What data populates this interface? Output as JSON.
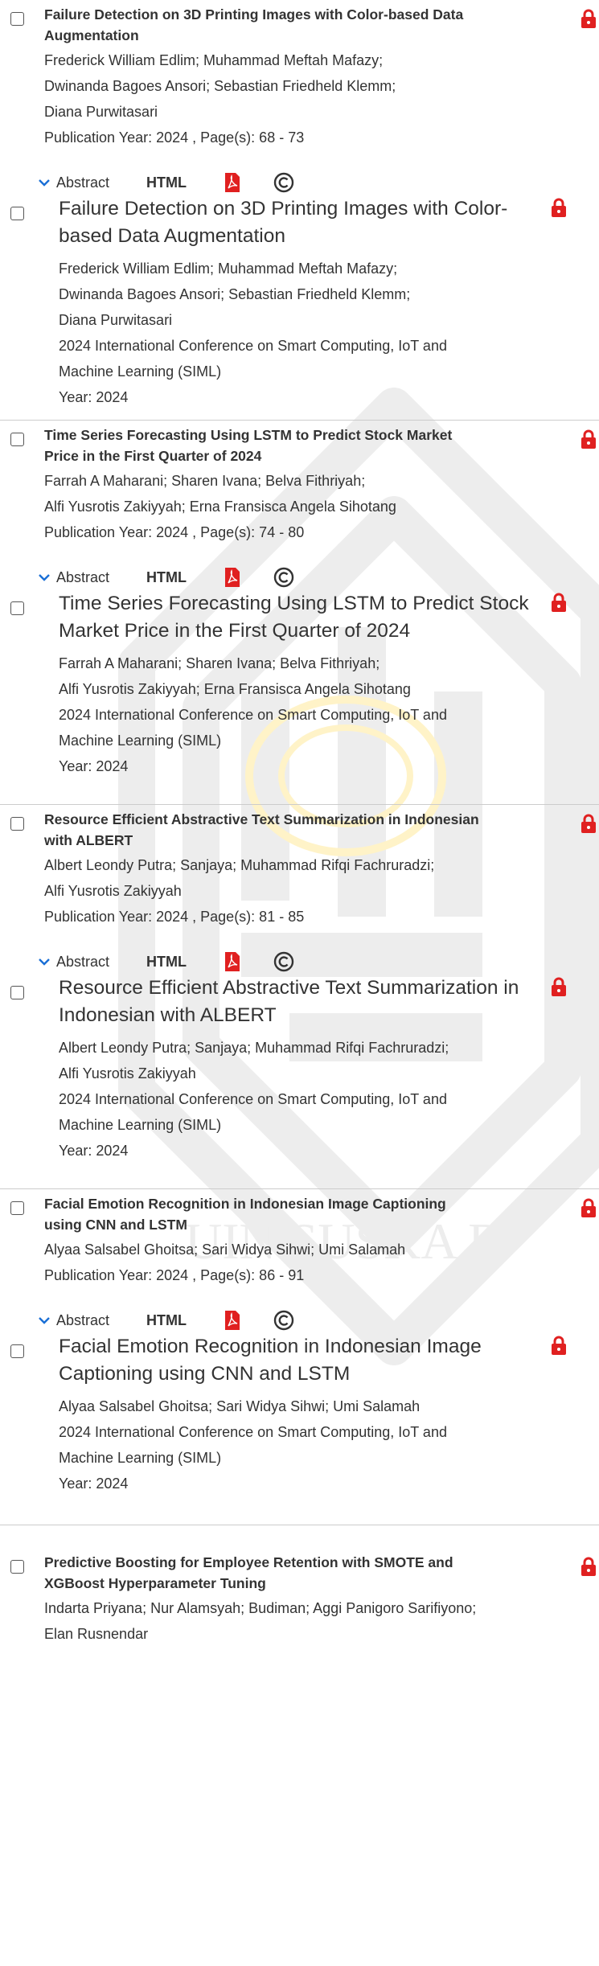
{
  "colors": {
    "accent_red": "#E02020",
    "text": "#333333",
    "watermark": "#EDEDED",
    "divider": "#CCCCCC"
  },
  "icons": {
    "checkbox": "checkbox-icon",
    "lock": "lock-icon",
    "chevron": "chevron-down-icon",
    "pdf": "pdf-icon",
    "copyright": "copyright-icon"
  },
  "labels": {
    "abstract": "Abstract",
    "html": "HTML"
  },
  "watermark_text": "UIN SUSKA R",
  "entries": [
    {
      "short_title": [
        "Failure Detection on 3D Printing Images with Color-based Data",
        "Augmentation"
      ],
      "authors": [
        "Frederick William Edlim; Muhammad Meftah Mafazy;",
        "Dwinanda Bagoes Ansori; Sebastian Friedheld Klemm;",
        "Diana Purwitasari"
      ],
      "pub_line": "Publication Year: 2024 , Page(s): 68  -  73",
      "full_title": [
        "Failure Detection on 3D Printing Images with Color-",
        "based Data Augmentation"
      ],
      "conference": [
        "2024 International Conference on Smart Computing, IoT and",
        "Machine Learning (SIML)"
      ],
      "year_line": "Year: 2024"
    },
    {
      "short_title": [
        "Time Series Forecasting Using LSTM to Predict Stock Market",
        "Price in the First Quarter of 2024"
      ],
      "authors": [
        "Farrah A Maharani; Sharen Ivana; Belva Fithriyah;",
        "Alfi Yusrotis Zakiyyah; Erna Fransisca Angela Sihotang"
      ],
      "pub_line": "Publication Year: 2024 , Page(s): 74  -  80",
      "full_title": [
        "Time Series Forecasting Using LSTM to Predict Stock",
        "Market Price in the First Quarter of 2024"
      ],
      "conference": [
        "2024 International Conference on Smart Computing, IoT and",
        "Machine Learning (SIML)"
      ],
      "year_line": "Year: 2024"
    },
    {
      "short_title": [
        "Resource Efficient Abstractive Text Summarization in Indonesian",
        "with ALBERT"
      ],
      "authors": [
        "Albert Leondy Putra; Sanjaya; Muhammad Rifqi Fachruradzi;",
        "Alfi Yusrotis Zakiyyah"
      ],
      "pub_line": "Publication Year: 2024 , Page(s): 81  -  85",
      "full_title": [
        "Resource Efficient Abstractive Text Summarization in",
        "Indonesian with ALBERT"
      ],
      "conference": [
        "2024 International Conference on Smart Computing, IoT and",
        "Machine Learning (SIML)"
      ],
      "year_line": "Year: 2024"
    },
    {
      "short_title": [
        "Facial Emotion Recognition in Indonesian Image Captioning",
        "using CNN and LSTM"
      ],
      "authors": [
        "Alyaa Salsabel Ghoitsa; Sari Widya Sihwi; Umi Salamah"
      ],
      "pub_line": "Publication Year: 2024 , Page(s): 86  -  91",
      "full_title": [
        "Facial Emotion Recognition in Indonesian Image",
        "Captioning using CNN and LSTM"
      ],
      "conference": [
        "2024 International Conference on Smart Computing, IoT and",
        "Machine Learning (SIML)"
      ],
      "year_line": "Year: 2024"
    },
    {
      "short_title": [
        "Predictive Boosting for Employee Retention with SMOTE and",
        "XGBoost Hyperparameter Tuning"
      ],
      "authors": [
        "Indarta Priyana; Nur Alamsyah; Budiman; Aggi Panigoro Sarifiyono;",
        "Elan Rusnendar"
      ]
    }
  ]
}
